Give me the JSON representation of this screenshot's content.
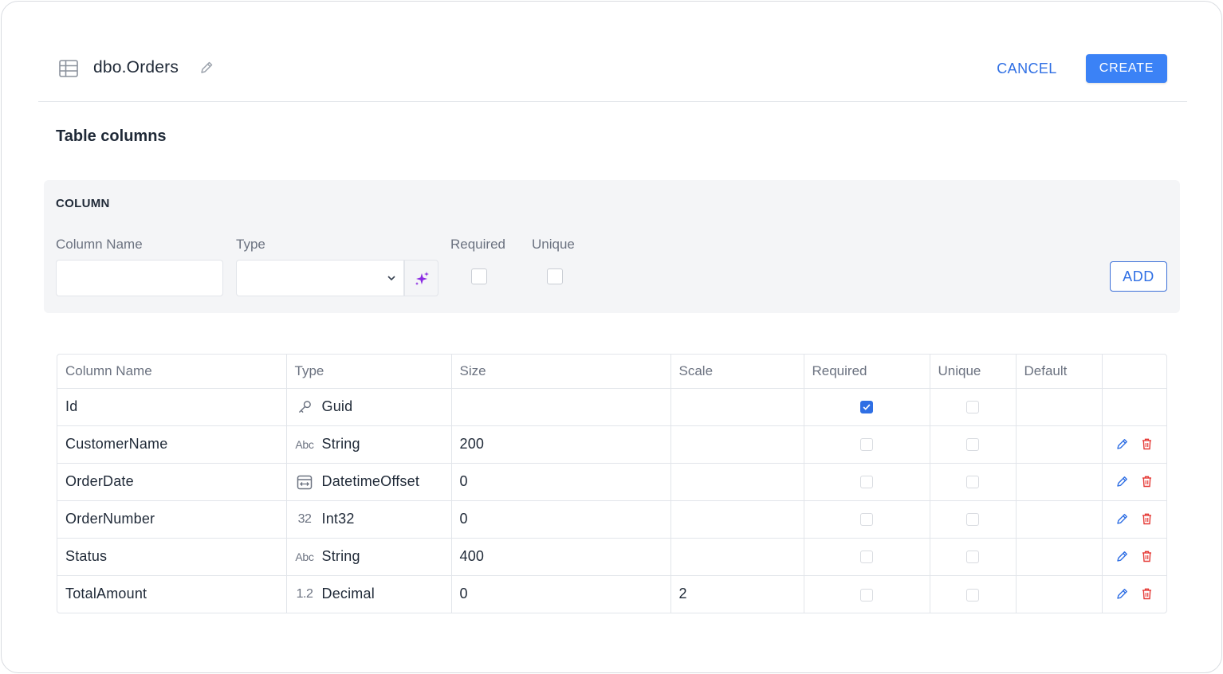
{
  "header": {
    "title": "dbo.Orders",
    "cancel_label": "CANCEL",
    "create_label": "CREATE"
  },
  "section_title": "Table columns",
  "new_column": {
    "heading": "COLUMN",
    "name_label": "Column Name",
    "type_label": "Type",
    "required_label": "Required",
    "unique_label": "Unique",
    "name_value": "",
    "type_value": "",
    "required_checked": false,
    "unique_checked": false,
    "add_label": "ADD"
  },
  "table": {
    "headers": [
      "Column Name",
      "Type",
      "Size",
      "Scale",
      "Required",
      "Unique",
      "Default",
      ""
    ],
    "rows": [
      {
        "name": "Id",
        "type_icon": "key-icon",
        "type": "Guid",
        "size": "",
        "scale": "",
        "required": true,
        "unique": false,
        "default": "",
        "actions": false
      },
      {
        "name": "CustomerName",
        "type_icon": "abc-icon",
        "type": "String",
        "size": "200",
        "scale": "",
        "required": false,
        "unique": false,
        "default": "",
        "actions": true
      },
      {
        "name": "OrderDate",
        "type_icon": "calendar-icon",
        "type": "DatetimeOffset",
        "size": "0",
        "scale": "",
        "required": false,
        "unique": false,
        "default": "",
        "actions": true
      },
      {
        "name": "OrderNumber",
        "type_icon": "integer-icon",
        "type": "Int32",
        "size": "0",
        "scale": "",
        "required": false,
        "unique": false,
        "default": "",
        "actions": true
      },
      {
        "name": "Status",
        "type_icon": "abc-icon",
        "type": "String",
        "size": "400",
        "scale": "",
        "required": false,
        "unique": false,
        "default": "",
        "actions": true
      },
      {
        "name": "TotalAmount",
        "type_icon": "decimal-icon",
        "type": "Decimal",
        "size": "0",
        "scale": "2",
        "required": false,
        "unique": false,
        "default": "",
        "actions": true
      }
    ]
  },
  "icon_glyphs": {
    "abc-icon": "Abc",
    "integer-icon": "32",
    "decimal-icon": "1.2"
  },
  "colors": {
    "accent": "#3b82f6",
    "link": "#2f6fe4",
    "danger": "#e53935",
    "magic": "#8b2be2"
  }
}
